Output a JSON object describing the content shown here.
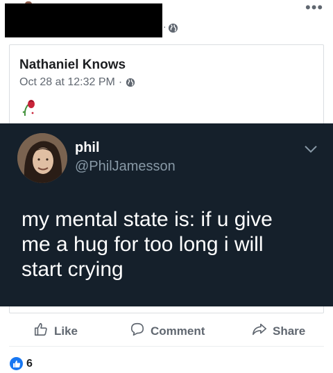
{
  "post": {
    "privacy_icon": "globe-icon",
    "more_icon": "ellipsis-icon",
    "dot": "·"
  },
  "shared_post": {
    "author": "Nathaniel Knows",
    "timestamp": "Oct 28 at 12:32 PM",
    "dot": "·",
    "privacy_icon": "globe-icon",
    "emoji_icon": "wilted-rose-icon"
  },
  "tweet": {
    "name": "phil",
    "handle": "@PhilJamesson",
    "lines": [
      "my mental state is: if u give",
      "me a hug for too long i will",
      "start crying"
    ],
    "background_color": "#15202b",
    "handle_color": "#8899a6"
  },
  "actions": {
    "like_label": "Like",
    "comment_label": "Comment",
    "share_label": "Share"
  },
  "reactions": {
    "count": "6",
    "icon": "like-reaction-icon",
    "color": "#1877f2"
  }
}
